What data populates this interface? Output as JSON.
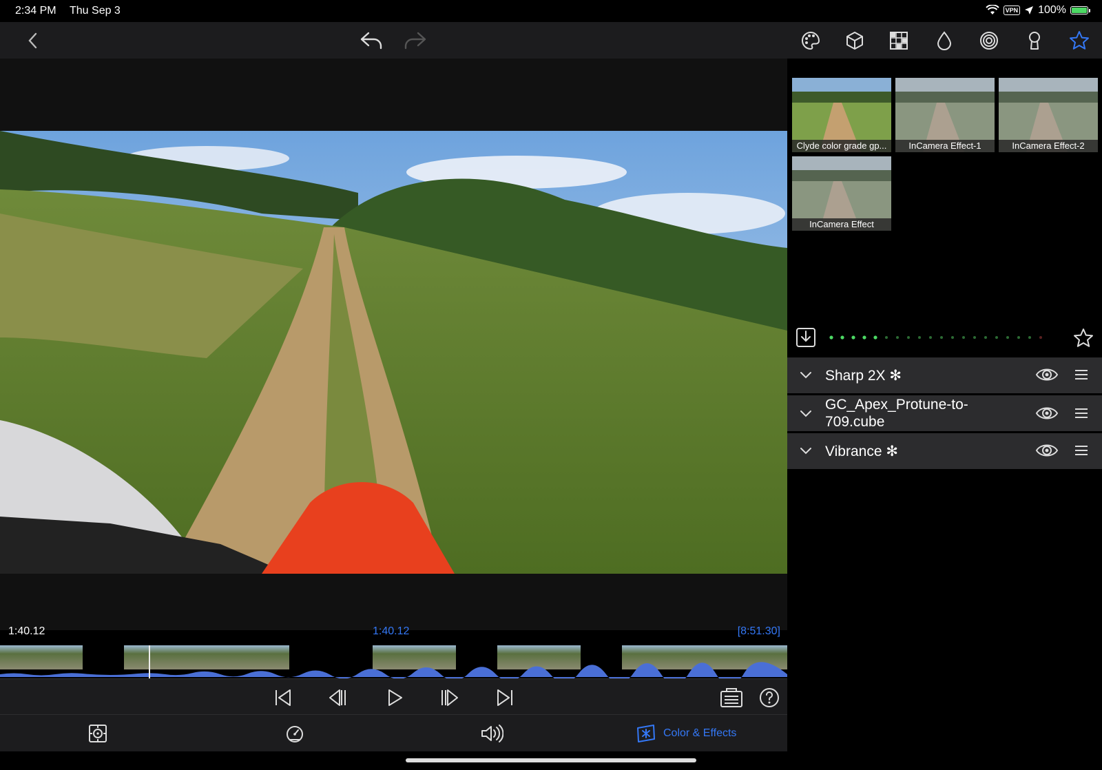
{
  "status": {
    "time": "2:34 PM",
    "date": "Thu Sep 3",
    "vpn": "VPN",
    "battery": "100%"
  },
  "colors": {
    "accent": "#3478f6",
    "panel": "#2c2c2e",
    "toolbar": "#1c1c1e",
    "green_dot": "#4cd964",
    "waveform": "#4a6fd6"
  },
  "toolbar": {
    "icons": [
      "back-icon",
      "undo-icon",
      "redo-icon",
      "palette-icon",
      "cube-icon",
      "grid-icon",
      "drop-icon",
      "spiral-icon",
      "keyhole-icon",
      "star-icon"
    ]
  },
  "presets": [
    {
      "label": "Clyde color grade gp..."
    },
    {
      "label": "InCamera Effect-1"
    },
    {
      "label": "InCamera Effect-2"
    },
    {
      "label": "InCamera Effect"
    }
  ],
  "effects": [
    {
      "name": "Sharp 2X ✻"
    },
    {
      "name": "GC_Apex_Protune-to-709.cube"
    },
    {
      "name": "Vibrance ✻"
    }
  ],
  "timeline": {
    "left_time": "1:40.12",
    "center_time": "1:40.12",
    "duration": "[8:51.30]"
  },
  "tabs": {
    "color_effects": "Color & Effects"
  }
}
